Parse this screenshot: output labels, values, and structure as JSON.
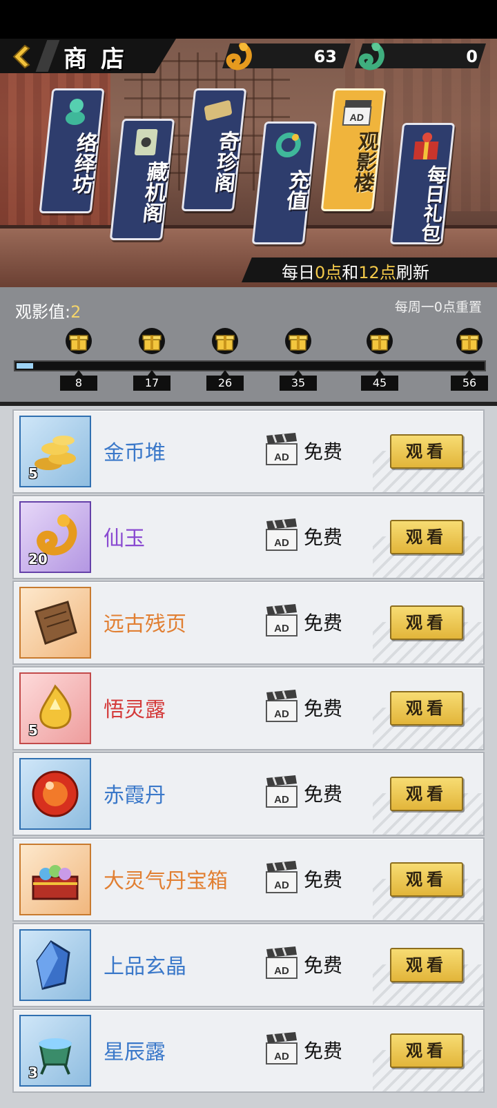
{
  "header": {
    "title": "商店",
    "currency_gold": {
      "value": "63",
      "icon": "gold-dragon-jade-icon"
    },
    "currency_jade": {
      "value": "0",
      "icon": "green-dragon-jade-icon"
    }
  },
  "tabs": [
    {
      "label": "络绎坊",
      "icon": "jade-dragon-statue-icon",
      "active": false
    },
    {
      "label": "藏机阁",
      "icon": "scroll-icon",
      "active": false
    },
    {
      "label": "奇珍阁",
      "icon": "treasure-scroll-icon",
      "active": false
    },
    {
      "label": "充值",
      "icon": "jade-ring-icon",
      "active": false
    },
    {
      "label": "观影楼",
      "icon": "ad-clapboard-icon",
      "active": true
    },
    {
      "label": "每日礼包",
      "icon": "gift-box-icon",
      "active": false
    }
  ],
  "refresh": {
    "prefix": "每日",
    "t1": "0点",
    "mid": "和",
    "t2": "12点",
    "suffix": "刷新"
  },
  "watch_progress": {
    "label": "观影值:",
    "value": "2",
    "weekly_reset": "每周一0点重置",
    "progress_fraction": 0.036,
    "milestones": [
      "8",
      "17",
      "26",
      "35",
      "45",
      "56"
    ]
  },
  "items": [
    {
      "name": "金币堆",
      "qty": "5",
      "rarity": "blue",
      "name_color": "#3a78c9",
      "icon": "gold-coins-icon",
      "price": "免费",
      "button": "观看"
    },
    {
      "name": "仙玉",
      "qty": "20",
      "rarity": "purple",
      "name_color": "#8a4ad1",
      "icon": "immortal-jade-icon",
      "price": "免费",
      "button": "观看"
    },
    {
      "name": "远古残页",
      "qty": "",
      "rarity": "orange",
      "name_color": "#e17f32",
      "icon": "ancient-page-icon",
      "price": "免费",
      "button": "观看"
    },
    {
      "name": "悟灵露",
      "qty": "5",
      "rarity": "red",
      "name_color": "#d43a3a",
      "icon": "spirit-dew-icon",
      "price": "免费",
      "button": "观看"
    },
    {
      "name": "赤霞丹",
      "qty": "",
      "rarity": "blue",
      "name_color": "#3a78c9",
      "icon": "red-pill-icon",
      "price": "免费",
      "button": "观看"
    },
    {
      "name": "大灵气丹宝箱",
      "qty": "",
      "rarity": "orange",
      "name_color": "#e17f32",
      "icon": "pill-chest-icon",
      "price": "免费",
      "button": "观看"
    },
    {
      "name": "上品玄晶",
      "qty": "",
      "rarity": "blue",
      "name_color": "#3a78c9",
      "icon": "blue-crystal-icon",
      "price": "免费",
      "button": "观看"
    },
    {
      "name": "星辰露",
      "qty": "3",
      "rarity": "blue",
      "name_color": "#3a78c9",
      "icon": "star-dew-cauldron-icon",
      "price": "免费",
      "button": "观看"
    }
  ]
}
